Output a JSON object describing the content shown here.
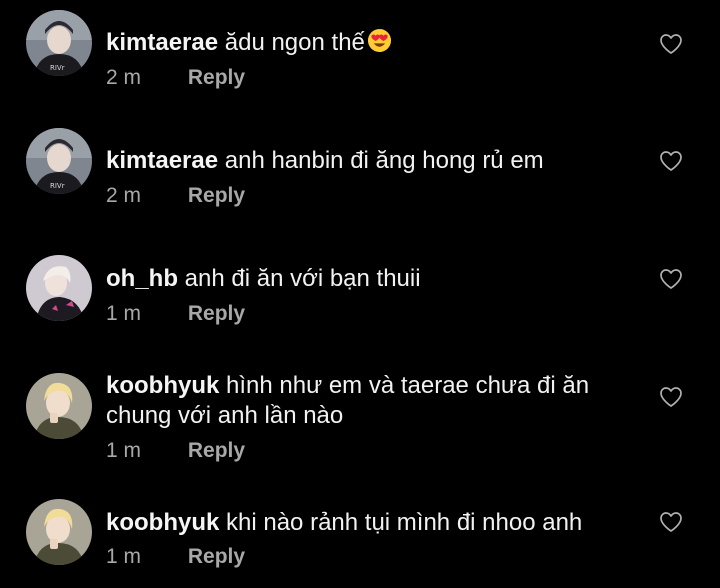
{
  "comments": [
    {
      "username": "kimtaerae",
      "text": "ădu ngon thế",
      "emoji": "heart-eyes",
      "time": "2 m",
      "reply": "Reply"
    },
    {
      "username": "kimtaerae",
      "text": "anh hanbin đi ăng hong rủ em",
      "time": "2 m",
      "reply": "Reply"
    },
    {
      "username": "oh_hb",
      "text": "anh đi ăn với bạn thuii",
      "time": "1 m",
      "reply": "Reply"
    },
    {
      "username": "koobhyuk",
      "text": "hình như em và taerae chưa đi ăn chung với anh lần nào",
      "time": "1 m",
      "reply": "Reply"
    },
    {
      "username": "koobhyuk",
      "text": "khi nào rảnh tụi mình đi nhoo anh",
      "time": "1 m",
      "reply": "Reply"
    }
  ],
  "colors": {
    "background": "#000000",
    "text": "#f2f2f2",
    "meta": "#a8a8a8",
    "heart_outline": "#b0b0b0"
  }
}
